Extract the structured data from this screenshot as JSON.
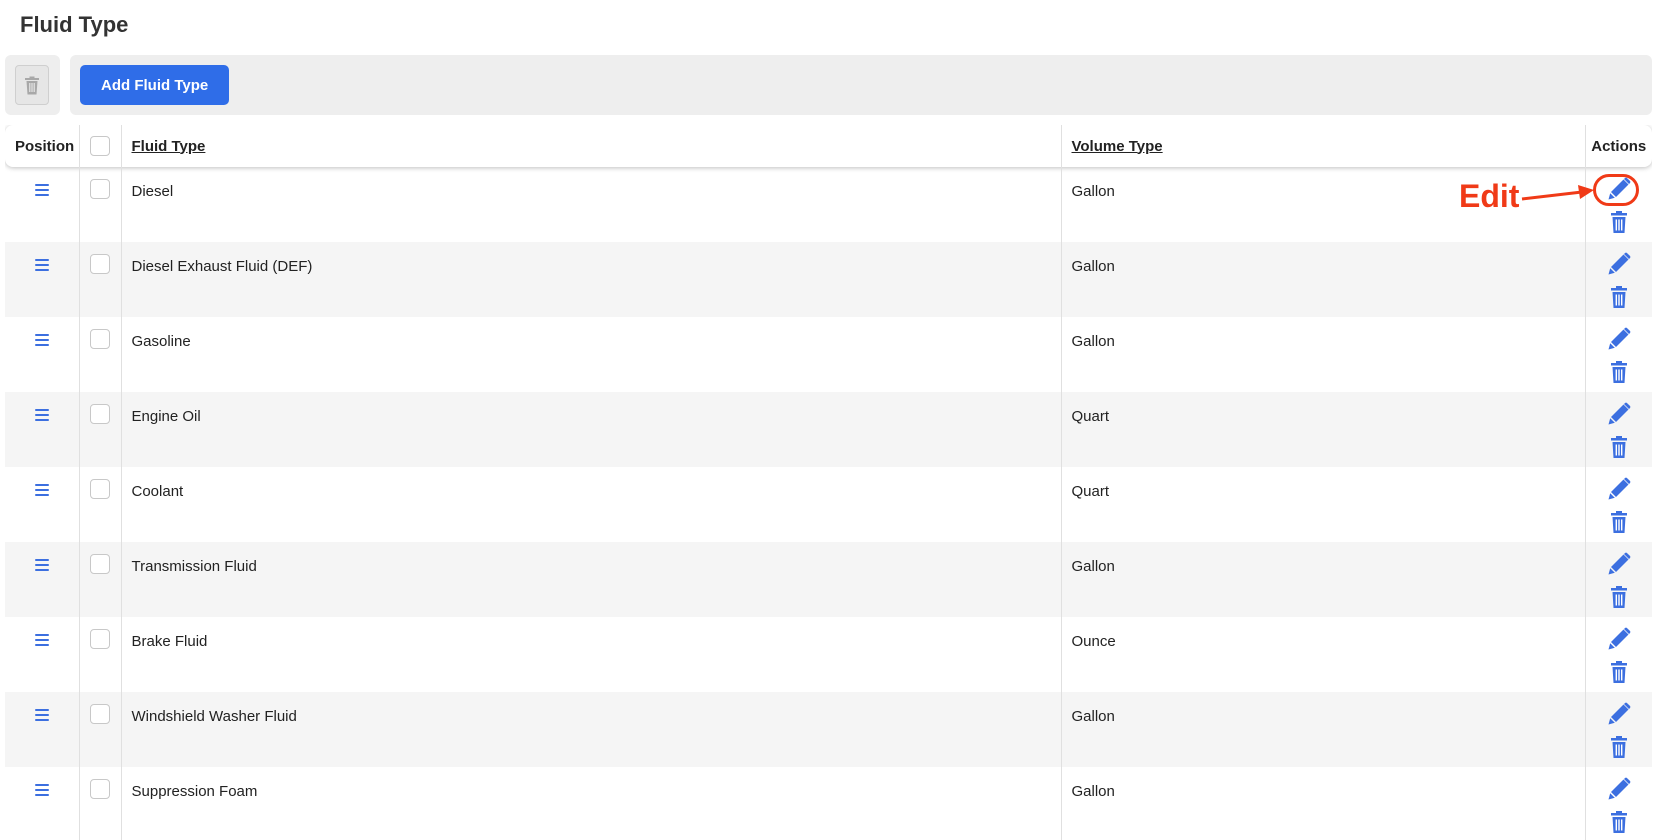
{
  "page": {
    "title": "Fluid Type"
  },
  "toolbar": {
    "add_label": "Add Fluid Type"
  },
  "table": {
    "headers": {
      "position": "Position",
      "fluid_type": "Fluid Type",
      "volume_type": "Volume Type",
      "actions": "Actions"
    },
    "rows": [
      {
        "fluid": "Diesel",
        "volume": "Gallon"
      },
      {
        "fluid": "Diesel Exhaust Fluid (DEF)",
        "volume": "Gallon"
      },
      {
        "fluid": "Gasoline",
        "volume": "Gallon"
      },
      {
        "fluid": "Engine Oil",
        "volume": "Quart"
      },
      {
        "fluid": "Coolant",
        "volume": "Quart"
      },
      {
        "fluid": "Transmission Fluid",
        "volume": "Gallon"
      },
      {
        "fluid": "Brake Fluid",
        "volume": "Ounce"
      },
      {
        "fluid": "Windshield Washer Fluid",
        "volume": "Gallon"
      },
      {
        "fluid": "Suppression Foam",
        "volume": "Gallon"
      }
    ]
  },
  "annotation": {
    "label": "Edit",
    "color": "#f03a17"
  },
  "colors": {
    "accent": "#2f6de8",
    "icon": "#3c6fe0"
  },
  "icons": [
    "trash-icon",
    "drag-handle-icon",
    "pencil-icon",
    "trash-icon"
  ]
}
